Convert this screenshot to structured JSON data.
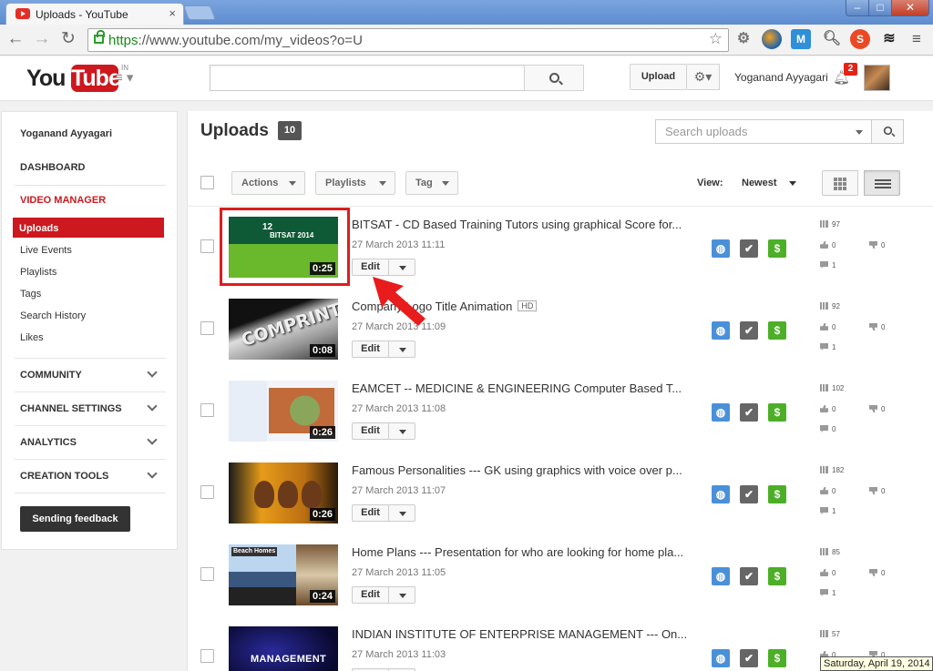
{
  "browser": {
    "tab_title": "Uploads - YouTube",
    "tab_close": "×",
    "url_https": "https",
    "url_rest": "://www.youtube.com/my_videos?o=U",
    "win_min": "–",
    "win_max": "□",
    "win_close": "✕"
  },
  "header": {
    "logo_you": "You",
    "logo_tube": "Tube",
    "logo_region": "IN",
    "upload_label": "Upload",
    "user_name": "Yoganand Ayyagari",
    "notification_count": "2"
  },
  "sidebar": {
    "channel_name": "Yoganand Ayyagari",
    "dashboard": "DASHBOARD",
    "video_manager": "VIDEO MANAGER",
    "items": [
      "Uploads",
      "Live Events",
      "Playlists",
      "Tags",
      "Search History",
      "Likes"
    ],
    "sections": [
      "COMMUNITY",
      "CHANNEL SETTINGS",
      "ANALYTICS",
      "CREATION TOOLS"
    ],
    "feedback_label": "Sending feedback"
  },
  "main": {
    "title": "Uploads",
    "count": "10",
    "search_placeholder": "Search uploads",
    "actions_label": "Actions",
    "playlists_label": "Playlists",
    "tag_label": "Tag",
    "view_label": "View:",
    "sort_label": "Newest",
    "edit_label": "Edit"
  },
  "videos": [
    {
      "title": "BITSAT - CD Based Training Tutors using graphical Score for...",
      "date": "27 March 2013 11:11",
      "duration": "0:25",
      "views": "97",
      "likes": "0",
      "dislikes": "0",
      "comments": "1",
      "hd": "",
      "thumb_text": "12",
      "thumb_sub": "BITSAT 2014"
    },
    {
      "title": "Company Logo Title Animation",
      "date": "27 March 2013 11:09",
      "duration": "0:08",
      "views": "92",
      "likes": "0",
      "dislikes": "0",
      "comments": "1",
      "hd": "HD",
      "thumb_text": "COMPRINT"
    },
    {
      "title": "EAMCET -- MEDICINE & ENGINEERING Computer Based T...",
      "date": "27 March 2013 11:08",
      "duration": "0:26",
      "views": "102",
      "likes": "0",
      "dislikes": "0",
      "comments": "0",
      "hd": ""
    },
    {
      "title": "Famous Personalities --- GK using graphics with voice over p...",
      "date": "27 March 2013 11:07",
      "duration": "0:26",
      "views": "182",
      "likes": "0",
      "dislikes": "0",
      "comments": "1",
      "hd": ""
    },
    {
      "title": "Home Plans --- Presentation for who are looking for home pla...",
      "date": "27 March 2013 11:05",
      "duration": "0:24",
      "views": "85",
      "likes": "0",
      "dislikes": "0",
      "comments": "1",
      "hd": "",
      "thumb_text": "Beach Homes"
    },
    {
      "title": "INDIAN INSTITUTE OF ENTERPRISE MANAGEMENT --- On...",
      "date": "27 March 2013 11:03",
      "duration": "",
      "views": "57",
      "likes": "0",
      "dislikes": "0",
      "comments": "",
      "hd": "",
      "thumb_text": "MANAGEMENT"
    }
  ],
  "icons": [
    "back-icon",
    "forward-icon",
    "reload-icon",
    "lock-icon",
    "star-icon",
    "gear-icon",
    "search-icon",
    "bell-icon",
    "menu-icon",
    "globe-icon",
    "check-icon",
    "dollar-icon",
    "chevron-down-icon",
    "grid-view-icon",
    "list-view-icon"
  ],
  "colors": {
    "brand_red": "#cc181e",
    "public_blue": "#4a90d9",
    "monetize_green": "#4caf27",
    "highlight_red": "#e01c1c"
  },
  "taskbar": {
    "clock_tooltip": "Saturday, April 19, 2014"
  }
}
